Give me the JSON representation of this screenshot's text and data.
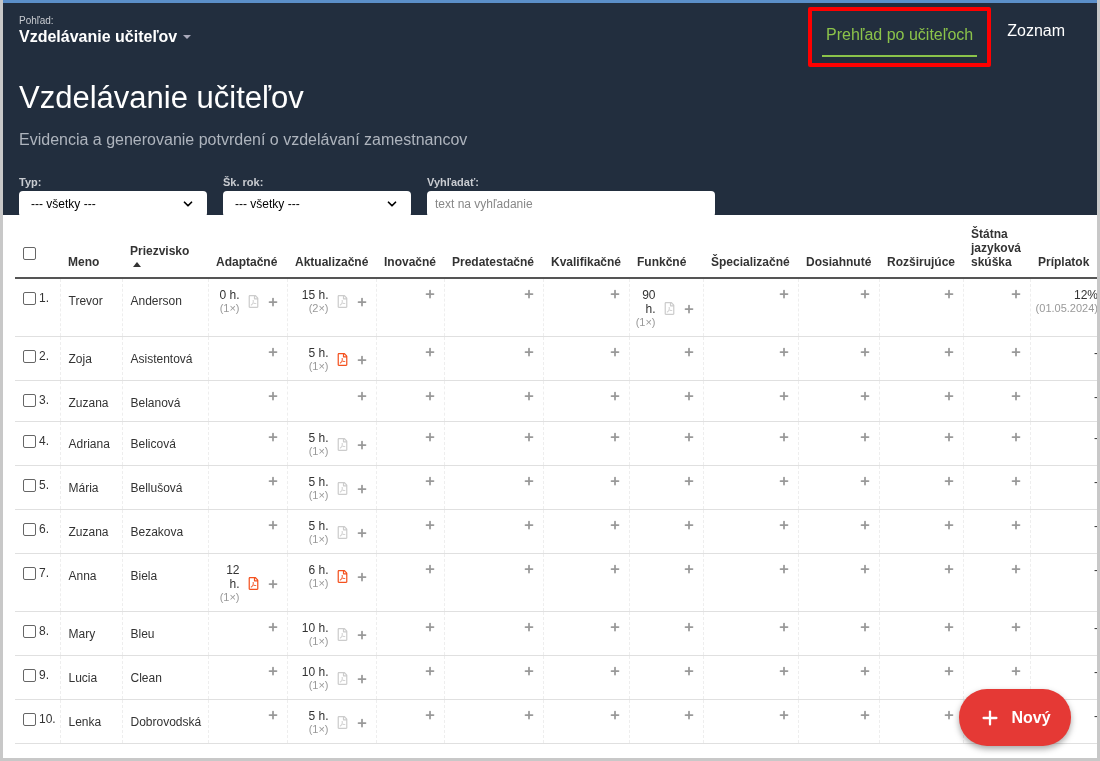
{
  "header": {
    "view_label": "Pohľad:",
    "view_name": "Vzdelávanie učiteľov",
    "title": "Vzdelávanie učiteľov",
    "subtitle": "Evidencia a generovanie potvrdení o vzdelávaní zamestnancov"
  },
  "tabs": [
    {
      "label": "Prehľad po učiteľoch",
      "selected": true,
      "highlighted": true
    },
    {
      "label": "Zoznam",
      "selected": false,
      "highlighted": false
    }
  ],
  "filters": [
    {
      "kind": "select",
      "label": "Typ:",
      "value": "--- všetky ---"
    },
    {
      "kind": "select",
      "label": "Šk. rok:",
      "value": "--- všetky ---"
    },
    {
      "kind": "search",
      "label": "Vyhľadať:",
      "placeholder": "text na vyhľadanie"
    }
  ],
  "table": {
    "select_all_checked": false,
    "columns": [
      {
        "label": "Meno",
        "sorted_ascending": false
      },
      {
        "label": "Priezvisko",
        "sorted_ascending": true
      },
      {
        "label": "Adaptačné",
        "sorted_ascending": false
      },
      {
        "label": "Aktualizačné",
        "sorted_ascending": false
      },
      {
        "label": "Inovačné",
        "sorted_ascending": false
      },
      {
        "label": "Predatestačné",
        "sorted_ascending": false
      },
      {
        "label": "Kvalifikačné",
        "sorted_ascending": false
      },
      {
        "label": "Funkčné",
        "sorted_ascending": false
      },
      {
        "label": "Špecializačné",
        "sorted_ascending": false
      },
      {
        "label": "Dosiahnuté",
        "sorted_ascending": false
      },
      {
        "label": "Rozširujúce",
        "sorted_ascending": false
      },
      {
        "label": "Štátna jazyková skúška",
        "sorted_ascending": false
      },
      {
        "label": "Príplatok",
        "sorted_ascending": false
      }
    ],
    "rows": [
      {
        "number": "1.",
        "checked": false,
        "cells": [
          {
            "kind": "text",
            "text": "Trevor"
          },
          {
            "kind": "text",
            "text": "Anderson"
          },
          {
            "kind": "record",
            "hours": "0 h.",
            "count": "(1×)",
            "pdf_active": false
          },
          {
            "kind": "record",
            "hours": "15 h.",
            "count": "(2×)",
            "pdf_active": false
          },
          {
            "kind": "empty"
          },
          {
            "kind": "empty"
          },
          {
            "kind": "empty"
          },
          {
            "kind": "record",
            "hours": "90 h.",
            "count": "(1×)",
            "pdf_active": false
          },
          {
            "kind": "empty"
          },
          {
            "kind": "empty"
          },
          {
            "kind": "empty"
          },
          {
            "kind": "empty"
          },
          {
            "kind": "surcharge",
            "value": "12%",
            "date": "(01.05.2024)"
          }
        ]
      },
      {
        "number": "2.",
        "checked": false,
        "cells": [
          {
            "kind": "text",
            "text": "Zoja"
          },
          {
            "kind": "text",
            "text": "Asistentová"
          },
          {
            "kind": "empty"
          },
          {
            "kind": "record",
            "hours": "5 h.",
            "count": "(1×)",
            "pdf_active": true
          },
          {
            "kind": "empty"
          },
          {
            "kind": "empty"
          },
          {
            "kind": "empty"
          },
          {
            "kind": "empty"
          },
          {
            "kind": "empty"
          },
          {
            "kind": "empty"
          },
          {
            "kind": "empty"
          },
          {
            "kind": "empty"
          },
          {
            "kind": "surcharge",
            "value": "-"
          }
        ]
      },
      {
        "number": "3.",
        "checked": false,
        "cells": [
          {
            "kind": "text",
            "text": "Zuzana"
          },
          {
            "kind": "text",
            "text": "Belanová"
          },
          {
            "kind": "empty"
          },
          {
            "kind": "empty"
          },
          {
            "kind": "empty"
          },
          {
            "kind": "empty"
          },
          {
            "kind": "empty"
          },
          {
            "kind": "empty"
          },
          {
            "kind": "empty"
          },
          {
            "kind": "empty"
          },
          {
            "kind": "empty"
          },
          {
            "kind": "empty"
          },
          {
            "kind": "surcharge",
            "value": "-"
          }
        ]
      },
      {
        "number": "4.",
        "checked": false,
        "cells": [
          {
            "kind": "text",
            "text": "Adriana"
          },
          {
            "kind": "text",
            "text": "Belicová"
          },
          {
            "kind": "empty"
          },
          {
            "kind": "record",
            "hours": "5 h.",
            "count": "(1×)",
            "pdf_active": false
          },
          {
            "kind": "empty"
          },
          {
            "kind": "empty"
          },
          {
            "kind": "empty"
          },
          {
            "kind": "empty"
          },
          {
            "kind": "empty"
          },
          {
            "kind": "empty"
          },
          {
            "kind": "empty"
          },
          {
            "kind": "empty"
          },
          {
            "kind": "surcharge",
            "value": "-"
          }
        ]
      },
      {
        "number": "5.",
        "checked": false,
        "cells": [
          {
            "kind": "text",
            "text": "Mária"
          },
          {
            "kind": "text",
            "text": "Bellušová"
          },
          {
            "kind": "empty"
          },
          {
            "kind": "record",
            "hours": "5 h.",
            "count": "(1×)",
            "pdf_active": false
          },
          {
            "kind": "empty"
          },
          {
            "kind": "empty"
          },
          {
            "kind": "empty"
          },
          {
            "kind": "empty"
          },
          {
            "kind": "empty"
          },
          {
            "kind": "empty"
          },
          {
            "kind": "empty"
          },
          {
            "kind": "empty"
          },
          {
            "kind": "surcharge",
            "value": "-"
          }
        ]
      },
      {
        "number": "6.",
        "checked": false,
        "cells": [
          {
            "kind": "text",
            "text": "Zuzana"
          },
          {
            "kind": "text",
            "text": "Bezakova"
          },
          {
            "kind": "empty"
          },
          {
            "kind": "record",
            "hours": "5 h.",
            "count": "(1×)",
            "pdf_active": false
          },
          {
            "kind": "empty"
          },
          {
            "kind": "empty"
          },
          {
            "kind": "empty"
          },
          {
            "kind": "empty"
          },
          {
            "kind": "empty"
          },
          {
            "kind": "empty"
          },
          {
            "kind": "empty"
          },
          {
            "kind": "empty"
          },
          {
            "kind": "surcharge",
            "value": "-"
          }
        ]
      },
      {
        "number": "7.",
        "checked": false,
        "cells": [
          {
            "kind": "text",
            "text": "Anna"
          },
          {
            "kind": "text",
            "text": "Biela"
          },
          {
            "kind": "record",
            "hours": "12 h.",
            "count": "(1×)",
            "pdf_active": true
          },
          {
            "kind": "record",
            "hours": "6 h.",
            "count": "(1×)",
            "pdf_active": true
          },
          {
            "kind": "empty"
          },
          {
            "kind": "empty"
          },
          {
            "kind": "empty"
          },
          {
            "kind": "empty"
          },
          {
            "kind": "empty"
          },
          {
            "kind": "empty"
          },
          {
            "kind": "empty"
          },
          {
            "kind": "empty"
          },
          {
            "kind": "surcharge",
            "value": "-"
          }
        ]
      },
      {
        "number": "8.",
        "checked": false,
        "cells": [
          {
            "kind": "text",
            "text": "Mary"
          },
          {
            "kind": "text",
            "text": "Bleu"
          },
          {
            "kind": "empty"
          },
          {
            "kind": "record",
            "hours": "10 h.",
            "count": "(1×)",
            "pdf_active": false
          },
          {
            "kind": "empty"
          },
          {
            "kind": "empty"
          },
          {
            "kind": "empty"
          },
          {
            "kind": "empty"
          },
          {
            "kind": "empty"
          },
          {
            "kind": "empty"
          },
          {
            "kind": "empty"
          },
          {
            "kind": "empty"
          },
          {
            "kind": "surcharge",
            "value": "-"
          }
        ]
      },
      {
        "number": "9.",
        "checked": false,
        "cells": [
          {
            "kind": "text",
            "text": "Lucia"
          },
          {
            "kind": "text",
            "text": "Clean"
          },
          {
            "kind": "empty"
          },
          {
            "kind": "record",
            "hours": "10 h.",
            "count": "(1×)",
            "pdf_active": false
          },
          {
            "kind": "empty"
          },
          {
            "kind": "empty"
          },
          {
            "kind": "empty"
          },
          {
            "kind": "empty"
          },
          {
            "kind": "empty"
          },
          {
            "kind": "empty"
          },
          {
            "kind": "empty"
          },
          {
            "kind": "empty"
          },
          {
            "kind": "surcharge",
            "value": "-"
          }
        ]
      },
      {
        "number": "10.",
        "checked": false,
        "cells": [
          {
            "kind": "text",
            "text": "Lenka"
          },
          {
            "kind": "text",
            "text": "Dobrovodská"
          },
          {
            "kind": "empty"
          },
          {
            "kind": "record",
            "hours": "5 h.",
            "count": "(1×)",
            "pdf_active": false
          },
          {
            "kind": "empty"
          },
          {
            "kind": "empty"
          },
          {
            "kind": "empty"
          },
          {
            "kind": "empty"
          },
          {
            "kind": "empty"
          },
          {
            "kind": "empty"
          },
          {
            "kind": "empty"
          },
          {
            "kind": "covered"
          },
          {
            "kind": "surcharge",
            "value": "-"
          }
        ]
      }
    ]
  },
  "fab": {
    "label": "Nový"
  }
}
